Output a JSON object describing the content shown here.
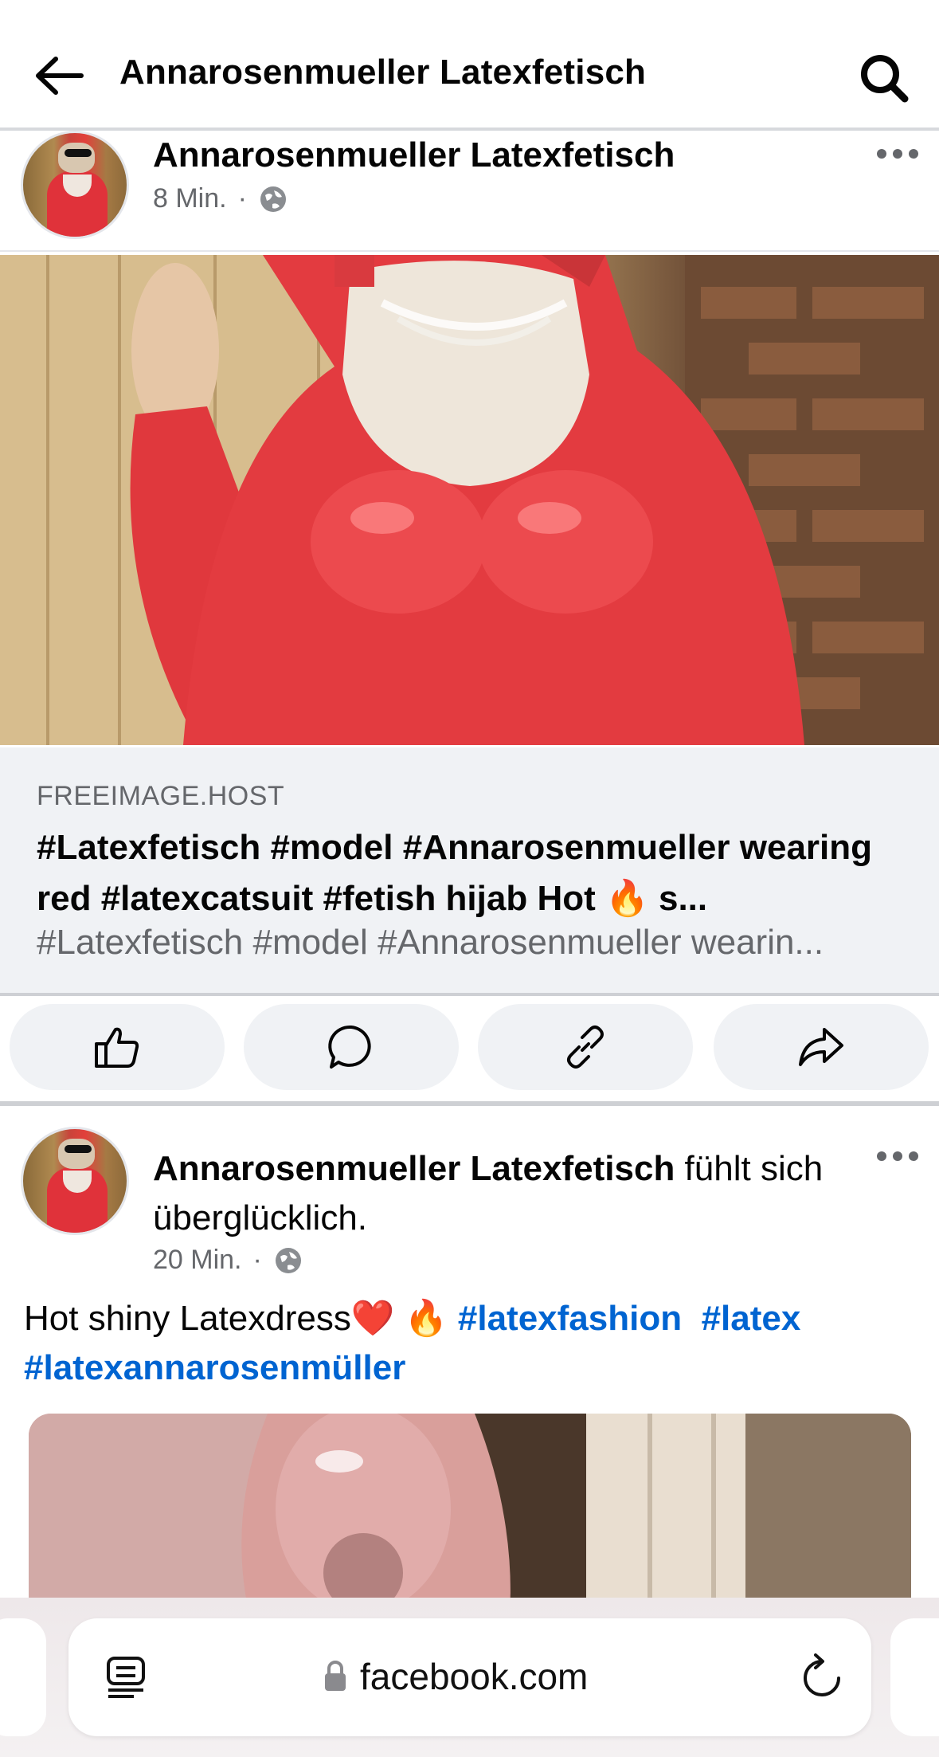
{
  "header": {
    "title": "Annarosenmueller Latexfetisch"
  },
  "post1": {
    "author": "Annarosenmueller Latexfetisch",
    "time": "8 Min.",
    "dot": "·",
    "link": {
      "source": "FREEIMAGE.HOST",
      "title": "#Latexfetisch #model #Annarosenmueller wearing red #latexcatsuit #fetish hijab Hot 🔥 s...",
      "description": "#Latexfetisch #model #Annarosenmueller wearin..."
    }
  },
  "post2": {
    "author": "Annarosenmueller Latexfetisch",
    "feeling": " fühlt sich überglücklich.",
    "time": "20 Min.",
    "dot": "·",
    "text": "Hot shiny Latexdress❤️ 🔥 ",
    "hashtags": [
      "#latexfashion",
      "#latex",
      "#latexannarosenmüller"
    ]
  },
  "browser": {
    "url": "facebook.com"
  },
  "icons": {
    "back": "arrow-left-icon",
    "search": "search-icon",
    "more": "more-horizontal-icon",
    "globe": "globe-icon",
    "like": "thumbs-up-icon",
    "comment": "comment-icon",
    "copy_link": "link-icon",
    "share": "share-icon",
    "reader": "reader-icon",
    "lock": "lock-icon",
    "reload": "reload-icon"
  },
  "colors": {
    "link_blue": "#0064d1",
    "meta_gray": "#65676b",
    "panel_gray": "#f0f2f5"
  }
}
